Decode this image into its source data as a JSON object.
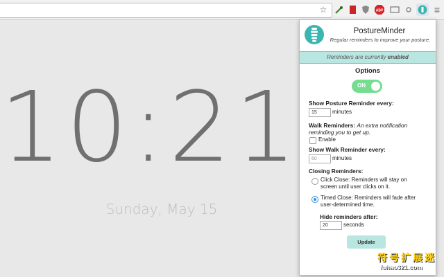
{
  "clock": {
    "time": "10:21",
    "date": "Sunday, May 15"
  },
  "toolbar": {
    "icons": [
      "star-icon",
      "eyedropper-icon",
      "bookmark-red-icon",
      "shield-icon",
      "adblock-icon",
      "screen-icon",
      "gear-icon",
      "postureminder-icon",
      "menu-icon"
    ],
    "adblock_label": "ABP"
  },
  "popup": {
    "title": "PostureMinder",
    "subtitle": "Regular reminders to improve your posture.",
    "status_prefix": "Reminders are currently ",
    "status_value": "enabled",
    "options_heading": "Options",
    "toggle_label": "ON",
    "posture": {
      "label": "Show Posture Reminder every:",
      "value": "15",
      "unit": "minutes"
    },
    "walk": {
      "label": "Walk Reminders:",
      "desc": "An extra notification reminding you to get up.",
      "enable_label": "Enable"
    },
    "walk_interval": {
      "label": "Show Walk Reminder every:",
      "value": "60",
      "unit": "minutes"
    },
    "closing": {
      "label": "Closing Reminders:",
      "click_close": "Click Close: Reminders will stay on screen until user clicks on it.",
      "timed_close": "Timed Close: Reminders will fade after user-determined time."
    },
    "hide": {
      "label": "Hide reminders after:",
      "value": "20",
      "unit": "seconds"
    },
    "update_label": "Update"
  },
  "watermark": {
    "cn": "符号扩展迷",
    "url": "fuhao321.com"
  },
  "colors": {
    "accent": "#b9e6e0",
    "toggle": "#76dc8f",
    "radio": "#3b8fe0"
  }
}
